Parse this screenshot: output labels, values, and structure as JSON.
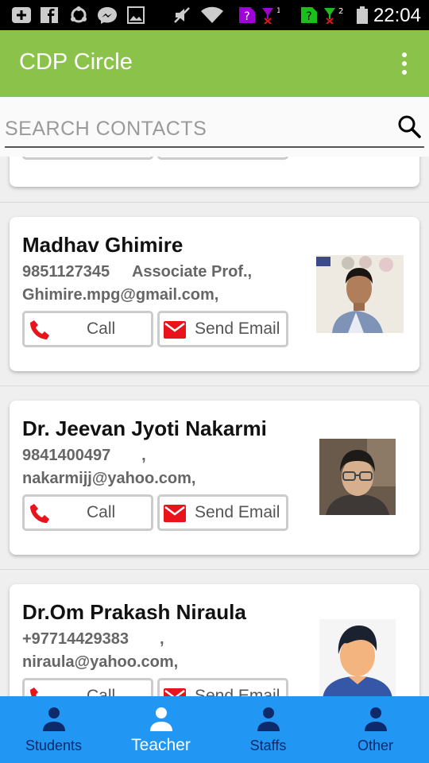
{
  "status_bar": {
    "time": "22:04"
  },
  "app_bar": {
    "title": "CDP Circle",
    "menu_icon": "more-vert-icon"
  },
  "search": {
    "placeholder": "SEARCH CONTACTS",
    "value": "",
    "icon": "search-icon"
  },
  "contacts": [
    {
      "name": "Madhav Ghimire",
      "phone": "9851127345",
      "position": "Associate Prof.,",
      "email": "Ghimire.mpg@gmail.com,",
      "call_label": "Call",
      "email_label": "Send Email"
    },
    {
      "name": "Dr. Jeevan Jyoti Nakarmi",
      "phone": "9841400497",
      "position": ",",
      "email": "nakarmijj@yahoo.com,",
      "call_label": "Call",
      "email_label": "Send Email"
    },
    {
      "name": "Dr.Om Prakash Niraula",
      "phone": "+97714429383",
      "position": ",",
      "email": "niraula@yahoo.com,",
      "call_label": "Call",
      "email_label": "Send Email"
    }
  ],
  "bottom_nav": {
    "active": "Teacher",
    "items": [
      {
        "label": "Students",
        "icon": "person-icon"
      },
      {
        "label": "Teacher",
        "icon": "person-icon"
      },
      {
        "label": "Staffs",
        "icon": "person-icon"
      },
      {
        "label": "Other",
        "icon": "person-icon"
      }
    ]
  },
  "colors": {
    "app_bar": "#8bc34a",
    "bottom_nav": "#2196f3",
    "icon_red": "#e8131b",
    "nav_inactive": "#0d2a6b"
  }
}
